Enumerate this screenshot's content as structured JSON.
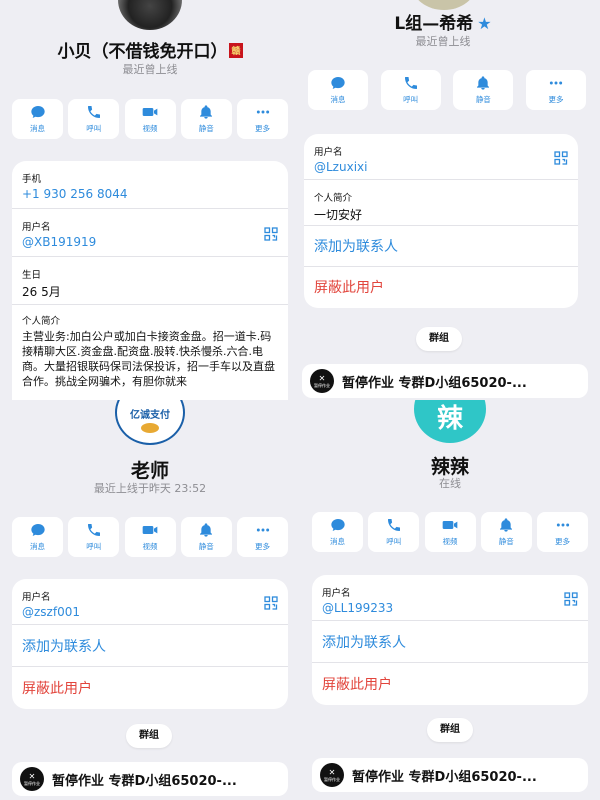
{
  "actions": {
    "message": "消息",
    "call": "呼叫",
    "video": "视频",
    "mute": "静音",
    "more": "更多"
  },
  "p1": {
    "name": "小贝（不借钱免开口）",
    "badge": "赣",
    "status": "最近曾上线",
    "phone_label": "手机",
    "phone": "+1 930 256 8044",
    "username_label": "用户名",
    "username": "@XB191919",
    "birthday_label": "生日",
    "birthday": "26 5月",
    "bio_label": "个人简介",
    "bio": "主营业务:加白公户或加白卡接资金盘。招一道卡.码接精聊大区.资金盘.配资盘.股转.快杀慢杀.六合.电商。大量招银联码保司法保投诉，招一手车以及直盘合作。挑战全网骗术，有胆你就来"
  },
  "p2": {
    "name": "L组—希希",
    "status": "最近曾上线",
    "username_label": "用户名",
    "username": "@Lzuxixi",
    "bio_label": "个人简介",
    "bio": "一切安好",
    "add_contact": "添加为联系人",
    "block": "屏蔽此用户",
    "groups_tab": "群组",
    "group_name": "暂停作业 专群D小组65020-...",
    "group_logo_text": "暂停作业"
  },
  "p3": {
    "avatar_text": "亿诚支付",
    "name": "老师",
    "status": "最近上线于昨天 23:52",
    "username_label": "用户名",
    "username": "@zszf001",
    "add_contact": "添加为联系人",
    "block": "屏蔽此用户",
    "groups_tab": "群组",
    "group_name": "暂停作业 专群D小组65020-...",
    "group_logo_text": "暂停作业"
  },
  "p4": {
    "avatar_text": "辣",
    "name": "辣辣",
    "status": "在线",
    "username_label": "用户名",
    "username": "@LL199233",
    "add_contact": "添加为联系人",
    "block": "屏蔽此用户",
    "groups_tab": "群组",
    "group_name": "暂停作业 专群D小组65020-...",
    "group_logo_text": "暂停作业"
  },
  "colors": {
    "accent": "#2e8bdc",
    "danger": "#e2453c",
    "avatar_teal": "#2fc6c7"
  },
  "icons": [
    "message-icon",
    "phone-icon",
    "video-icon",
    "bell-icon",
    "more-icon",
    "qr-code-icon",
    "star-icon"
  ]
}
